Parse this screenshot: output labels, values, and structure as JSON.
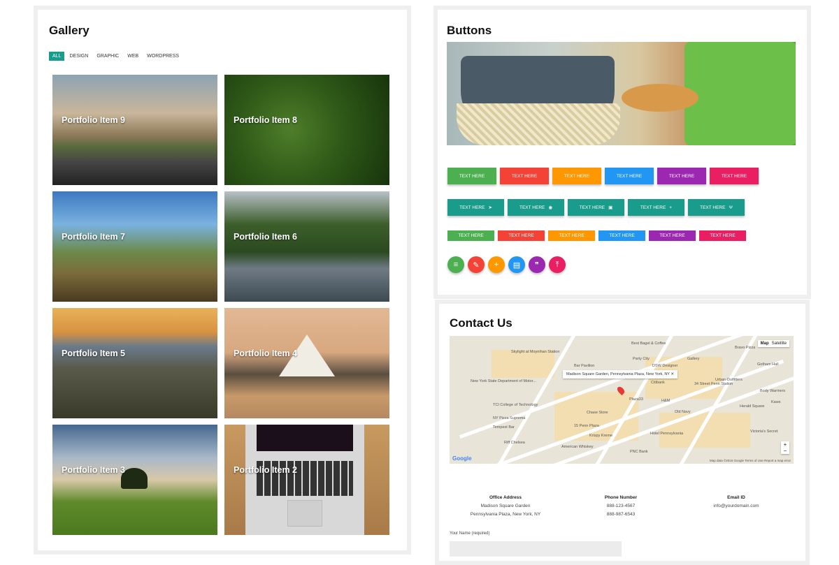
{
  "gallery": {
    "title": "Gallery",
    "filters": [
      "ALL",
      "DESIGN",
      "GRAPHIC",
      "WEB",
      "WORDPRESS"
    ],
    "active_filter": "ALL",
    "items": [
      "Portfolio Item 9",
      "Portfolio Item 8",
      "Portfolio Item 7",
      "Portfolio Item 6",
      "Portfolio Item 5",
      "Portfolio Item 4",
      "Portfolio Item 3",
      "Portfolio Item 2"
    ]
  },
  "buttons": {
    "title": "Buttons",
    "label": "TEXT HERE",
    "row1": [
      "TEXT HERE",
      "TEXT HERE",
      "TEXT HERE",
      "TEXT HERE",
      "TEXT HERE",
      "TEXT HERE"
    ],
    "row2": [
      {
        "label": "TEXT HERE",
        "icon": "send-icon",
        "glyph": "➤"
      },
      {
        "label": "TEXT HERE",
        "icon": "compass-icon",
        "glyph": "◉"
      },
      {
        "label": "TEXT HERE",
        "icon": "camera-icon",
        "glyph": "▣"
      },
      {
        "label": "TEXT HERE",
        "icon": "plus-icon",
        "glyph": "+"
      },
      {
        "label": "TEXT HERE",
        "icon": "usb-icon",
        "glyph": "ψ"
      }
    ],
    "row3": [
      "TEXT HERE",
      "TEXT HERE",
      "TEXT HERE",
      "TEXT HERE",
      "TEXT HERE",
      "TEXT HERE"
    ],
    "round": [
      {
        "icon": "menu-icon",
        "glyph": "≡"
      },
      {
        "icon": "pencil-icon",
        "glyph": "✎"
      },
      {
        "icon": "plus-icon",
        "glyph": "+"
      },
      {
        "icon": "save-icon",
        "glyph": "▤"
      },
      {
        "icon": "quote-icon",
        "glyph": "❞"
      },
      {
        "icon": "upload-icon",
        "glyph": "⤒"
      }
    ],
    "colors": {
      "green": "#4caf50",
      "red": "#f44336",
      "orange": "#ff9800",
      "blue": "#2196f3",
      "purple": "#9c27b0",
      "pink": "#e91e63",
      "teal": "#1a9c8c"
    }
  },
  "contact": {
    "title": "Contact Us",
    "map": {
      "popup": "Madison Square Garden, Pennsylvania Plaza, New York, NY",
      "type_map": "Map",
      "type_satellite": "Satellite",
      "labels": [
        "New York State Department of Motor...",
        "TCI College of Technology",
        "NY Pizza Suprema",
        "Tempest Bar",
        "Riff Chelsea",
        "Chase Store",
        "15 Penn Plaza",
        "Krispy Kreme",
        "Plaza33",
        "Citibank",
        "H&M",
        "Old Navy",
        "Hotel Pennsylvania",
        "PNC Bank",
        "American Whiskey",
        "Skylight at Moynihan Station",
        "Best Bagel & Coffee",
        "Gallery",
        "Bravo Pizza",
        "Gotham Hall",
        "Herald Square",
        "Kaws",
        "Victoria's Secret",
        "Body Warmers",
        "Urban Outfitters",
        "DSW Designer",
        "Party City",
        "Bar Pavilion",
        "34 Street Penn Station"
      ],
      "footer": "Map data ©2016 Google  Terms of Use  Report a map error",
      "logo": "Google"
    },
    "office": {
      "head": "Office Address",
      "line1": "Madison Square Garden",
      "line2": "Pennsylvania Plaza, New York, NY"
    },
    "phone": {
      "head": "Phone Number",
      "line1": "888-123-4567",
      "line2": "888-987-6543"
    },
    "email": {
      "head": "Email ID",
      "line1": "info@yourdomain.com"
    },
    "name_label": "Your Name (required)"
  }
}
